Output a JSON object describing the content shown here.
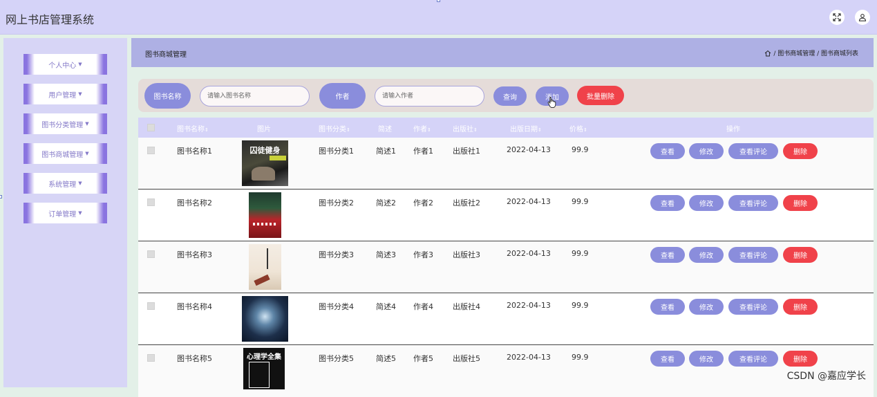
{
  "app": {
    "title": "网上书店管理系统"
  },
  "header_icons": [
    "fullscreen-icon",
    "user-icon"
  ],
  "sidebar": {
    "items": [
      {
        "label": "个人中心"
      },
      {
        "label": "用户管理"
      },
      {
        "label": "图书分类管理"
      },
      {
        "label": "图书商城管理"
      },
      {
        "label": "系统管理"
      },
      {
        "label": "订单管理"
      }
    ]
  },
  "breadcrumb": {
    "title": "图书商城管理",
    "path": "/ 图书商城管理 / 图书商城列表"
  },
  "search": {
    "name_label": "图书名称",
    "name_placeholder": "请输入图书名称",
    "name_value": "",
    "author_label": "作者",
    "author_placeholder": "请输入作者",
    "author_value": "",
    "query_label": "查询",
    "add_label": "添加",
    "batch_delete_label": "批量删除"
  },
  "table": {
    "headers": {
      "name": "图书名称",
      "image": "图片",
      "category": "图书分类",
      "summary": "简述",
      "author": "作者",
      "publisher": "出版社",
      "date": "出版日期",
      "price": "价格",
      "actions": "操作"
    },
    "sort_glyph": "⇕",
    "actions": {
      "view": "查看",
      "edit": "修改",
      "reviews": "查看评论",
      "delete": "删除"
    },
    "rows": [
      {
        "name": "图书名称1",
        "category": "图书分类1",
        "summary": "简述1",
        "author": "作者1",
        "publisher": "出版社1",
        "date": "2022-04-13",
        "price": "99.9",
        "cover_text": "囚徒健身"
      },
      {
        "name": "图书名称2",
        "category": "图书分类2",
        "summary": "简述2",
        "author": "作者2",
        "publisher": "出版社2",
        "date": "2022-04-13",
        "price": "99.9",
        "cover_text": ""
      },
      {
        "name": "图书名称3",
        "category": "图书分类3",
        "summary": "简述3",
        "author": "作者3",
        "publisher": "出版社3",
        "date": "2022-04-13",
        "price": "99.9",
        "cover_text": ""
      },
      {
        "name": "图书名称4",
        "category": "图书分类4",
        "summary": "简述4",
        "author": "作者4",
        "publisher": "出版社4",
        "date": "2022-04-13",
        "price": "99.9",
        "cover_text": ""
      },
      {
        "name": "图书名称5",
        "category": "图书分类5",
        "summary": "简述5",
        "author": "作者5",
        "publisher": "出版社5",
        "date": "2022-04-13",
        "price": "99.9",
        "cover_text": "心理学全集"
      }
    ]
  },
  "watermark": "CSDN @嘉应学长",
  "colors": {
    "header_bg": "#d5d3f8",
    "accent": "#8a8ddc",
    "danger": "#f0424a"
  }
}
